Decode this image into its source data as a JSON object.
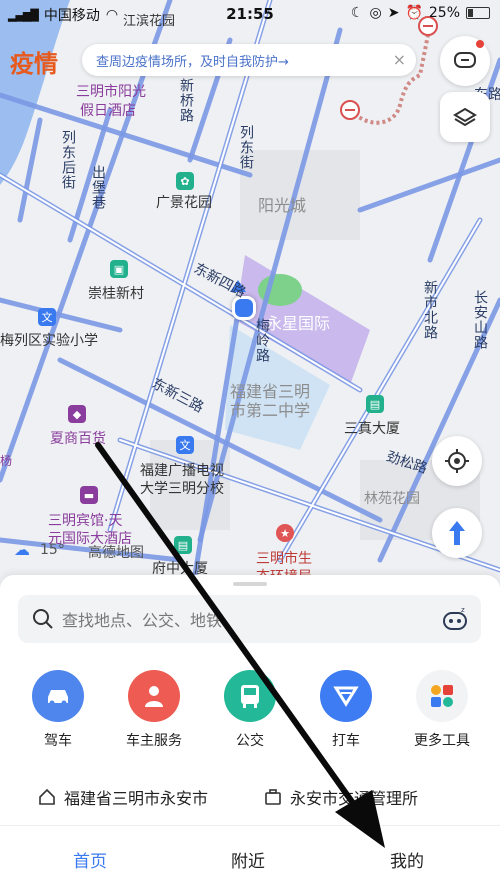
{
  "status": {
    "carrier": "中国移动",
    "time": "21:55",
    "battery": "25%",
    "battery_level": 0.25
  },
  "top": {
    "promo": "疫情",
    "notice": "查周边疫情场所，及时自我防护→",
    "notice_close": "×"
  },
  "map": {
    "labels": {
      "jiangbin": "江滨花园",
      "sanming_yangguang": "三明市阳光",
      "jiari_hotel": "假日酒店",
      "guangjing": "广景花园",
      "yangguang_city": "阳光城",
      "chonggui": "崇桂新村",
      "yongxing": "永星国际",
      "meiling_road": "梅岭路",
      "dongxin4_road": "东新四路",
      "dongxin3_road": "东新三路",
      "liedong_street": "列东街",
      "liedong_back_street": "列东后街",
      "xinqiao_road": "新桥路",
      "chubao_lane": "出堡巷",
      "xinshi_north_road": "新市北路",
      "changshan_road": "长安山路",
      "lie_school": "梅列区实验小学",
      "xiashang": "夏商百货",
      "no2_school_line1": "福建省三明",
      "no2_school_line2": "市第二中学",
      "sanzhen": "三真大厦",
      "jingsong_road": "劲松路",
      "linyuan": "林苑花园",
      "tv_univ_line1": "福建广播电视",
      "tv_univ_line2": "大学三明分校",
      "sanming_hotel_line1": "三明宾馆·天",
      "sanming_hotel_line2": "元国际大酒店",
      "gaode_map": "高德地图",
      "weather": "15°",
      "fuzhong": "府中大厦",
      "center_line1": "三明市生",
      "center_line2": "态环境局",
      "east_road": "东路",
      "yang": "杨"
    }
  },
  "sheet": {
    "search_placeholder": "查找地点、公交、地铁",
    "services": [
      {
        "label": "驾车",
        "color": "#4f86ee"
      },
      {
        "label": "车主服务",
        "color": "#ee5b52"
      },
      {
        "label": "公交",
        "color": "#23b897"
      },
      {
        "label": "打车",
        "color": "#3d7cf2"
      },
      {
        "label": "更多工具",
        "color": "#f2f3f5"
      }
    ],
    "recent": [
      "福建省三明市永安市",
      "永安市交通管理所"
    ],
    "tabs": [
      "首页",
      "附近",
      "我的"
    ],
    "active_tab": "首页"
  },
  "colors": {
    "road": "#7b98e4",
    "location_dot": "#3a7af0",
    "active_tab": "#3a7af0",
    "purple_area": "#c9b9ec",
    "school_area": "#cfe3f5"
  }
}
